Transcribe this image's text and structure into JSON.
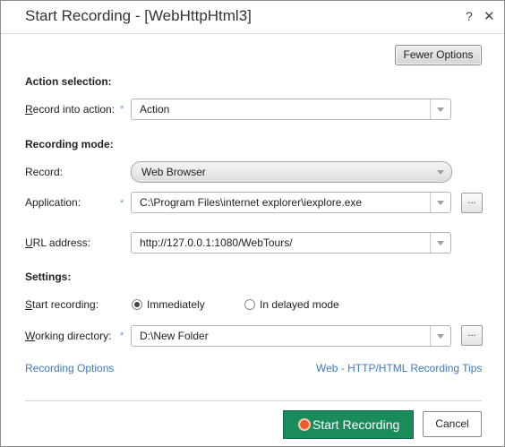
{
  "window": {
    "title": "Start Recording - [WebHttpHtml3]",
    "help_icon": "?",
    "close_icon": "✕"
  },
  "fewer_options_label": "Fewer Options",
  "action_selection": {
    "heading": "Action selection:",
    "record_into_label_key": "R",
    "record_into_label_rest": "ecord into action:",
    "record_into_value": "Action"
  },
  "recording_mode": {
    "heading": "Recording mode:",
    "record_label": "Record:",
    "record_value": "Web Browser",
    "application_label": "Application:",
    "application_value": "C:\\Program Files\\internet explorer\\iexplore.exe",
    "url_label_key": "U",
    "url_label_rest": "RL address:",
    "url_value": "http://127.0.0.1:1080/WebTours/",
    "browse_label": "..."
  },
  "settings": {
    "heading": "Settings:",
    "start_recording_label_key": "S",
    "start_recording_label_rest": "tart recording:",
    "option_immediately": "Immediately",
    "option_delayed": "In delayed mode",
    "working_dir_label_key": "W",
    "working_dir_label_rest": "orking directory:",
    "working_dir_value": "D:\\New Folder",
    "browse_label": "..."
  },
  "required_marker": "*",
  "links": {
    "recording_options": "Recording Options",
    "tips": "Web - HTTP/HTML Recording Tips"
  },
  "buttons": {
    "start_recording": "Start Recording",
    "cancel": "Cancel"
  },
  "colors": {
    "accent": "#1a8c5b",
    "link": "#3b7bbf",
    "required": "#5b9bd5"
  }
}
